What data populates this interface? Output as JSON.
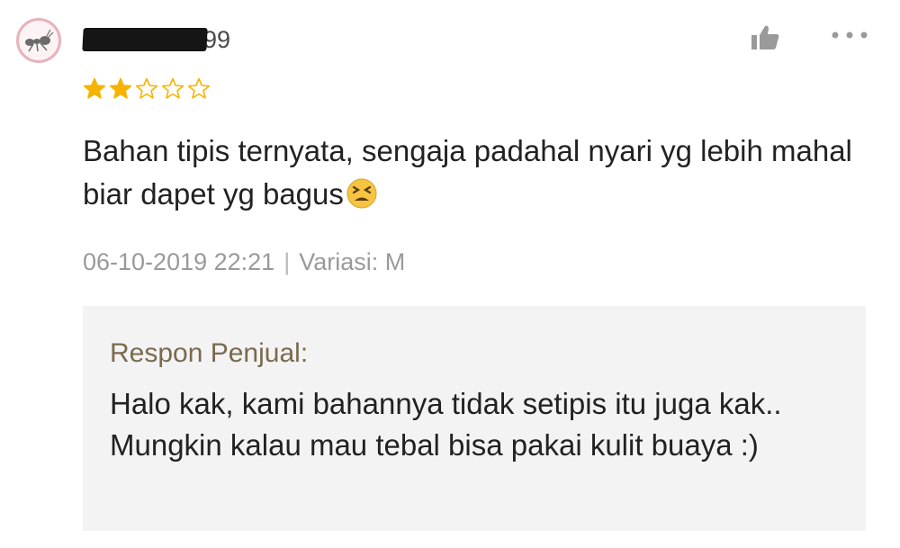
{
  "review": {
    "username_visible_suffix": "99",
    "rating": 2,
    "rating_max": 5,
    "text": "Bahan tipis ternyata, sengaja padahal nyari yg lebih mahal biar dapet yg bagus",
    "emoji": "tired-face-emoji",
    "date": "06-10-2019 22:21",
    "separator": "|",
    "variation": "Variasi: M"
  },
  "icons": {
    "avatar": "ant-avatar-icon",
    "like": "thumbs-up-icon",
    "more": "more-options-icon",
    "star_filled": "star-filled-icon",
    "star_empty": "star-empty-icon"
  },
  "seller_response": {
    "title": "Respon Penjual:",
    "text": "Halo kak, kami bahannya tidak setipis itu juga kak.. Mungkin kalau mau tebal bisa pakai kulit buaya :)"
  },
  "colors": {
    "star": "#f6b300",
    "avatar_border": "#e7b3ba",
    "seller_title": "#7a6a4e",
    "seller_bg": "#f3f3f3",
    "meta": "#9a9a9a"
  }
}
